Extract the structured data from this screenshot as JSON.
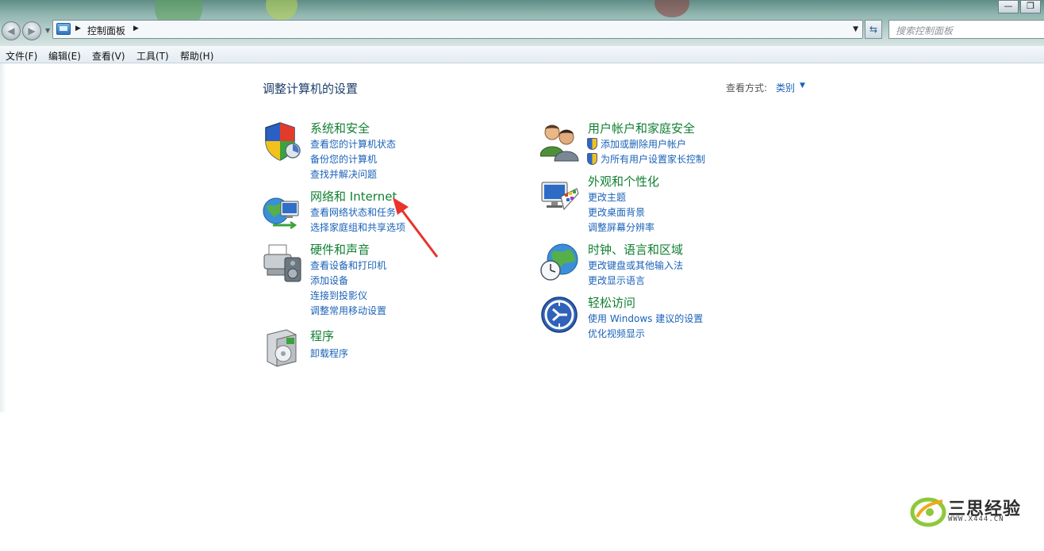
{
  "address_bar": {
    "breadcrumb": "控制面板",
    "search_placeholder": "搜索控制面板"
  },
  "window_buttons": {
    "minimize": "—",
    "maximize": "❐"
  },
  "menu": [
    "文件(F)",
    "编辑(E)",
    "查看(V)",
    "工具(T)",
    "帮助(H)"
  ],
  "page": {
    "title": "调整计算机的设置",
    "view_by_label": "查看方式:",
    "view_by_value": "类别"
  },
  "categories": [
    {
      "title": "系统和安全",
      "icon": "shield-icon",
      "links": [
        "查看您的计算机状态",
        "备份您的计算机",
        "查找并解决问题"
      ]
    },
    {
      "title": "网络和 Internet",
      "icon": "network-globe-icon",
      "links": [
        "查看网络状态和任务",
        "选择家庭组和共享选项"
      ]
    },
    {
      "title": "硬件和声音",
      "icon": "printer-speaker-icon",
      "links": [
        "查看设备和打印机",
        "添加设备",
        "连接到投影仪",
        "调整常用移动设置"
      ]
    },
    {
      "title": "程序",
      "icon": "programs-box-icon",
      "links": [
        "卸载程序"
      ]
    },
    {
      "title": "用户帐户和家庭安全",
      "icon": "users-icon",
      "links": [
        "添加或删除用户帐户",
        "为所有用户设置家长控制"
      ]
    },
    {
      "title": "外观和个性化",
      "icon": "display-palette-icon",
      "links": [
        "更改主题",
        "更改桌面背景",
        "调整屏幕分辨率"
      ]
    },
    {
      "title": "时钟、语言和区域",
      "icon": "clock-globe-icon",
      "links": [
        "更改键盘或其他输入法",
        "更改显示语言"
      ]
    },
    {
      "title": "轻松访问",
      "icon": "accessibility-icon",
      "links": [
        "使用 Windows 建议的设置",
        "优化视频显示"
      ]
    }
  ],
  "annotation": {
    "icon": "red-arrow-icon",
    "color": "#e8342c"
  },
  "watermark": {
    "name": "三思经验",
    "url": "WWW.X444.CN"
  },
  "colors": {
    "link": "#1a62b8",
    "category_title": "#118032",
    "page_title": "#1c3d6b"
  }
}
